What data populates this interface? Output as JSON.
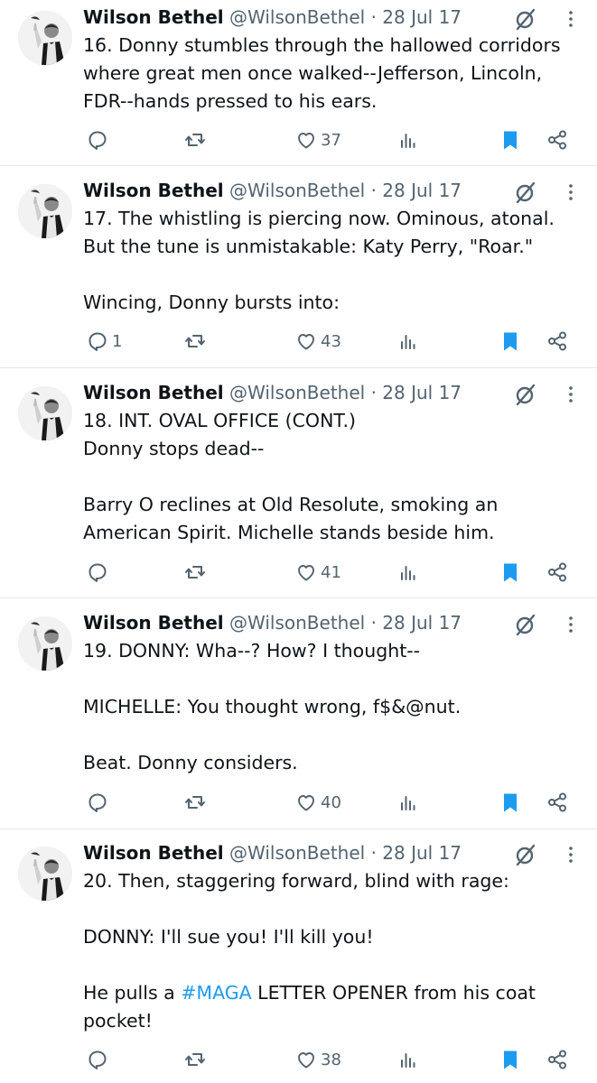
{
  "tweets": [
    {
      "name": "Wilson Bethel",
      "handle": "@WilsonBethel",
      "sep": "·",
      "date": "28 Jul 17",
      "text": "16. Donny stumbles through the hallowed corridors where great men once walked--Jefferson, Lincoln, FDR--hands pressed to his ears.",
      "reply_count": "",
      "like_count": "37"
    },
    {
      "name": "Wilson Bethel",
      "handle": "@WilsonBethel",
      "sep": "·",
      "date": "28 Jul 17",
      "text": "17. The whistling is piercing now. Ominous, atonal. But the tune is unmistakable: Katy Perry, \"Roar.\"\n\nWincing, Donny bursts into:",
      "reply_count": "1",
      "like_count": "43"
    },
    {
      "name": "Wilson Bethel",
      "handle": "@WilsonBethel",
      "sep": "·",
      "date": "28 Jul 17",
      "text": "18. INT. OVAL OFFICE (CONT.)\nDonny stops dead--\n\nBarry O reclines at Old Resolute, smoking an American Spirit. Michelle stands beside him.",
      "reply_count": "",
      "like_count": "41"
    },
    {
      "name": "Wilson Bethel",
      "handle": "@WilsonBethel",
      "sep": "·",
      "date": "28 Jul 17",
      "text": "19. DONNY: Wha--? How? I thought--\n\nMICHELLE: You thought wrong, f$&@nut.\n\nBeat. Donny considers.",
      "reply_count": "",
      "like_count": "40"
    },
    {
      "name": "Wilson Bethel",
      "handle": "@WilsonBethel",
      "sep": "·",
      "date": "28 Jul 17",
      "text_before": "20. Then, staggering forward, blind with rage:\n\nDONNY: I'll sue you! I'll kill you!\n\nHe pulls a ",
      "hashtag": "#MAGA",
      "text_after": " LETTER OPENER from his coat pocket!",
      "reply_count": "",
      "like_count": "38"
    }
  ],
  "icons": {
    "reply": "reply-icon",
    "retweet": "retweet-icon",
    "like": "like-icon",
    "views": "views-icon",
    "bookmark": "bookmark-icon",
    "share": "share-icon",
    "grok": "grok-icon",
    "more": "more-icon"
  },
  "colors": {
    "text": "#0f1419",
    "secondary": "#536471",
    "accent": "#1d9bf0",
    "divider": "#e6e9ec"
  }
}
